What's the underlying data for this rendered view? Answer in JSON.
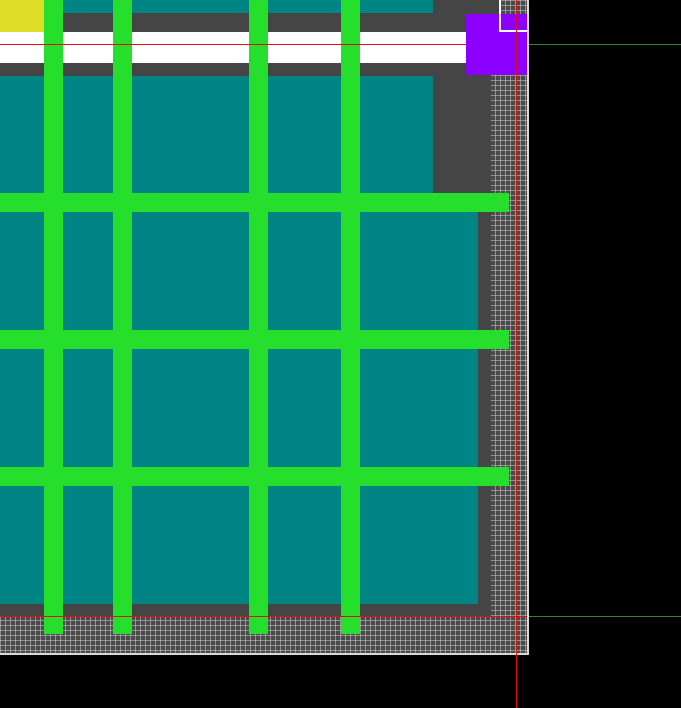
{
  "view": {
    "background_color": "#000000",
    "board_background_color": "#4a4a4a",
    "panel_color": "#454545",
    "edge_color": "#d9d9d9"
  },
  "layers": {
    "substrate_color": "#008484",
    "routing_color": "#26de2c",
    "power_rail_color": "#ffffff",
    "pad_color": "#dddd2a",
    "selected_cell_color": "#8c00ff"
  },
  "guides": {
    "vertical_guide_color": "#e01010",
    "horizontal_guide_color": "#2a8a2a"
  },
  "icons": {
    "corner_marker": "corner-marker-icon"
  }
}
